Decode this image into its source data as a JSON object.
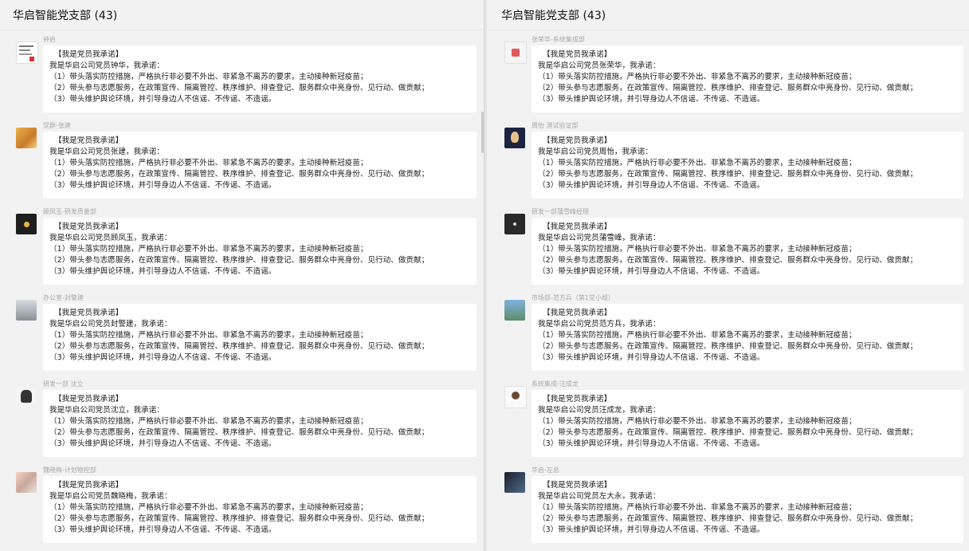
{
  "left": {
    "title": "华启智能党支部 (43)",
    "messages": [
      {
        "sender": "钟启",
        "lines": [
          "【我是党员我承诺】",
          "我是华启公司党员钟华，我承诺：",
          "（1）带头落实防控措施，严格执行非必要不外出、非紧急不离苏的要求，主动接种新冠疫苗；",
          "（2）带头参与志愿服务，在政策宣传、隔离管控、秩序维护、排查登记、服务群众中亮身份、见行动、做贡献；",
          "（3）带头维护舆论环境，并引导身边人不信谣、不传谣、不造谣。"
        ]
      },
      {
        "sender": "党群-张建",
        "lines": [
          "【我是党员我承诺】",
          "我是华启公司党员张建，我承诺：",
          "（1）带头落实防控措施，严格执行非必要不外出、非紧急不离苏的要求，主动接种新冠疫苗；",
          "（2）带头参与志愿服务，在政策宣传、隔离管控、秩序维护、排查登记、服务群众中亮身份、见行动、做贡献；",
          "（3）带头维护舆论环境，并引导身边人不信谣、不传谣、不造谣。"
        ]
      },
      {
        "sender": "顾凤玉-研发质量部",
        "lines": [
          "【我是党员我承诺】",
          "我是华启公司党员顾凤玉，我承诺：",
          "（1）带头落实防控措施，严格执行非必要不外出、非紧急不离苏的要求，主动接种新冠疫苗；",
          "（2）带头参与志愿服务，在政策宣传、隔离管控、秩序维护、排查登记、服务群众中亮身份、见行动、做贡献；",
          "（3）带头维护舆论环境，并引导身边人不信谣、不传谣、不造谣。"
        ]
      },
      {
        "sender": "办公室-封警建",
        "lines": [
          "【我是党员我承诺】",
          "我是华启公司党员封警建，我承诺：",
          "（1）带头落实防控措施，严格执行非必要不外出、非紧急不离苏的要求，主动接种新冠疫苗；",
          "（2）带头参与志愿服务，在政策宣传、隔离管控、秩序维护、排查登记、服务群众中亮身份、见行动、做贡献；",
          "（3）带头维护舆论环境，并引导身边人不信谣、不传谣、不造谣。"
        ]
      },
      {
        "sender": "研发一部 沈立",
        "lines": [
          "【我是党员我承诺】",
          "我是华启公司党员沈立，我承诺：",
          "（1）带头落实防控措施，严格执行非必要不外出、非紧急不离苏的要求，主动接种新冠疫苗；",
          "（2）带头参与志愿服务，在政策宣传、隔离管控、秩序维护、排查登记、服务群众中亮身份、见行动、做贡献；",
          "（3）带头维护舆论环境，并引导身边人不信谣、不传谣、不造谣。"
        ]
      },
      {
        "sender": "魏晓梅-计划物控部",
        "lines": [
          "【我是党员我承诺】",
          "我是华启公司党员魏晓梅，我承诺：",
          "（1）带头落实防控措施，严格执行非必要不外出、非紧急不离苏的要求，主动接种新冠疫苗；",
          "（2）带头参与志愿服务，在政策宣传、隔离管控、秩序维护、排查登记、服务群众中亮身份、见行动、做贡献；",
          "（3）带头维护舆论环境，并引导身边人不信谣、不传谣、不造谣。"
        ]
      }
    ]
  },
  "right": {
    "title": "华启智能党支部 (43)",
    "messages": [
      {
        "sender": "张荣华-系统集成部",
        "lines": [
          "【我是党员我承诺】",
          "我是华启公司党员张荣华，我承诺：",
          "（1）带头落实防控措施，严格执行非必要不外出、非紧急不离苏的要求，主动接种新冠疫苗；",
          "（2）带头参与志愿服务，在政策宣传、隔离管控、秩序维护、排查登记、服务群众中亮身份、见行动、做贡献；",
          "（3）带头维护舆论环境，并引导身边人不信谣、不传谣、不造谣。"
        ]
      },
      {
        "sender": "周怡 测试验证部",
        "lines": [
          "【我是党员我承诺】",
          "我是华启公司党员周怡，我承诺：",
          "（1）带头落实防控措施，严格执行非必要不外出、非紧急不离苏的要求，主动接种新冠疫苗；",
          "（2）带头参与志愿服务，在政策宣传、隔离管控、秩序维护、排查登记、服务群众中亮身份、见行动、做贡献；",
          "（3）带头维护舆论环境，并引导身边人不信谣、不传谣、不造谣。"
        ]
      },
      {
        "sender": "研发一部蒲雪峰经理",
        "lines": [
          "【我是党员我承诺】",
          "我是华启公司党员蒲雪峰，我承诺：",
          "（1）带头落实防控措施，严格执行非必要不外出、非紧急不离苏的要求，主动接种新冠疫苗；",
          "（2）带头参与志愿服务，在政策宣传、隔离管控、秩序维护、排查登记、服务群众中亮身份、见行动、做贡献；",
          "（3）带头维护舆论环境，并引导身边人不信谣、不传谣、不造谣。"
        ]
      },
      {
        "sender": "市场部-范方兵（第1党小组）",
        "lines": [
          "【我是党员我承诺】",
          "我是华启公司党员范方兵，我承诺：",
          "（1）带头落实防控措施，严格执行非必要不外出、非紧急不离苏的要求，主动接种新冠疫苗；",
          "（2）带头参与志愿服务，在政策宣传、隔离管控、秩序维护、排查登记、服务群众中亮身份、见行动、做贡献；",
          "（3）带头维护舆论环境，并引导身边人不信谣、不传谣、不造谣。"
        ]
      },
      {
        "sender": "系统集成-汪成龙",
        "lines": [
          "【我是党员我承诺】",
          "我是华启公司党员汪成龙，我承诺：",
          "（1）带头落实防控措施，严格执行非必要不外出、非紧急不离苏的要求，主动接种新冠疫苗；",
          "（2）带头参与志愿服务，在政策宣传、隔离管控、秩序维护、排查登记、服务群众中亮身份、见行动、做贡献；",
          "（3）带头维护舆论环境，并引导身边人不信谣、不传谣、不造谣。"
        ]
      },
      {
        "sender": "华启-左总",
        "lines": [
          "【我是党员我承诺】",
          "我是华启公司党员左大永，我承诺：",
          "（1）带头落实防控措施，严格执行非必要不外出、非紧急不离苏的要求，主动接种新冠疫苗；",
          "（2）带头参与志愿服务，在政策宣传、隔离管控、秩序维护、排查登记、服务群众中亮身份、见行动、做贡献；",
          "（3）带头维护舆论环境，并引导身边人不信谣、不传谣、不造谣。"
        ]
      }
    ]
  }
}
